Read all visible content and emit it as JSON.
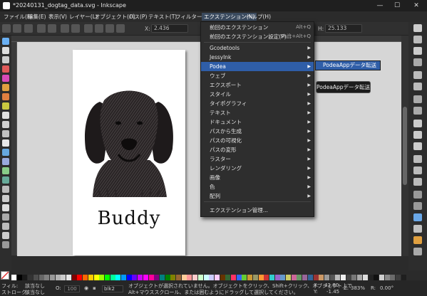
{
  "window": {
    "title": "*20240131_dogtag_data.svg - Inkscape",
    "minimize": "—",
    "maximize": "☐",
    "close": "✕"
  },
  "menubar": {
    "items": [
      "ファイル(F)",
      "編集(E)",
      "表示(V)",
      "レイヤー(L)",
      "オブジェクト(O)",
      "パス(P)",
      "テキスト(T)",
      "フィルター(S)",
      "エクステンション(N)",
      "ヘルプ(H)"
    ]
  },
  "toolbar": {
    "x_label": "X:",
    "x_value": "2.436",
    "y_label": "H:",
    "y_value": "25.133"
  },
  "canvas": {
    "text": "Buddy",
    "image_name": "dog-illustration"
  },
  "extensions_menu": {
    "items": [
      {
        "label": "前回のエクステンション",
        "shortcut": "Alt+Q"
      },
      {
        "label": "前回のエクステンション設定(P)...",
        "shortcut": "Shift+Alt+Q"
      },
      {
        "label": "Gcodetools"
      },
      {
        "label": "JessyInk"
      },
      {
        "label": "Podea"
      },
      {
        "label": "ウェブ"
      },
      {
        "label": "エクスポート"
      },
      {
        "label": "スタイル"
      },
      {
        "label": "タイポグラフィ"
      },
      {
        "label": "テキスト"
      },
      {
        "label": "ドキュメント"
      },
      {
        "label": "パスから生成"
      },
      {
        "label": "パスの可視化"
      },
      {
        "label": "パスの変形"
      },
      {
        "label": "ラスター"
      },
      {
        "label": "レンダリング"
      },
      {
        "label": "画像"
      },
      {
        "label": "色"
      },
      {
        "label": "配列"
      },
      {
        "label": "エクステンション管理..."
      }
    ],
    "highlighted": "Podea"
  },
  "submenu": {
    "item": "PodeaAppデータ転送"
  },
  "tooltip": {
    "text": "PodeaAppデータ転送"
  },
  "palette": {
    "colors": [
      "#ffffff",
      "#000000",
      "#1a1a1a",
      "#333333",
      "#4d4d4d",
      "#666666",
      "#808080",
      "#999999",
      "#b3b3b3",
      "#cccccc",
      "#e6e6e6",
      "#800000",
      "#ff0000",
      "#ff6600",
      "#ffcc00",
      "#ffff00",
      "#99ff00",
      "#00ff00",
      "#00ff99",
      "#00ffff",
      "#0099ff",
      "#0000ff",
      "#6600ff",
      "#cc00ff",
      "#ff00ff",
      "#ff0099",
      "#800080",
      "#008080",
      "#008000",
      "#808000",
      "#996633",
      "#ffcc99",
      "#ff9999",
      "#ffcccc",
      "#ccffcc",
      "#ccffff",
      "#ccccff",
      "#ffccff",
      "#663300",
      "#336633",
      "#ff3366",
      "#3366ff",
      "#66cc33",
      "#cc9933",
      "#999966",
      "#ff9933",
      "#cc3333",
      "#33cccc",
      "#9966cc",
      "#6699cc",
      "#cccc66",
      "#cc6699",
      "#669966",
      "#996699",
      "#336699",
      "#993333",
      "#cc9966",
      "#999999",
      "#555555",
      "#bbbbbb",
      "#eeeeee",
      "#444444",
      "#777777",
      "#aaaaaa",
      "#dddddd",
      "#222222",
      "#111111",
      "#cfcfcf",
      "#8a8a8a",
      "#6b6b6b",
      "#3d3d3d",
      "#1f1f1f"
    ]
  },
  "status": {
    "fill_label": "フィル:",
    "fill_value": "該当なし",
    "stroke_label": "ストローク:",
    "stroke_value": "該当なし",
    "opacity_label": "O:",
    "opacity_value": "100",
    "layer": "blk2",
    "message_line1": "オブジェクトが選択されていません。オブジェクトをクリック、Shift+クリック、オブジェクト上で",
    "message_line2": "Alt+マウススクロール、または囲むようにドラッグして選択してください。",
    "x_label": "X:",
    "x_value": "42.60",
    "y_label": "Y:",
    "y_value": "-1.45",
    "zoom_label": "Z:",
    "zoom_value": "383%",
    "rotate_label": "R:",
    "rotate_value": "0.00°"
  },
  "colors": {
    "menu_highlight": "#2f5ea8",
    "window_bg": "#2b2b2b",
    "canvas_bg": "#d6d6d6"
  }
}
